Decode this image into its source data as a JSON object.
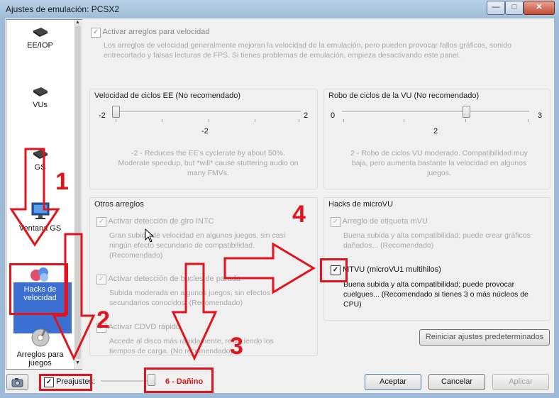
{
  "window": {
    "title": "Ajustes de emulación: PCSX2",
    "minimize": "—",
    "maximize": "□",
    "close": "✕"
  },
  "sidebar": {
    "items": [
      {
        "label": "EE/IOP",
        "icon": "chip-icon"
      },
      {
        "label": "VUs",
        "icon": "chip-icon"
      },
      {
        "label": "GS",
        "icon": "chip-icon"
      },
      {
        "label": "Ventana GS",
        "icon": "monitor-icon"
      },
      {
        "label": "Hacks de velocidad",
        "icon": "hacks-icon",
        "selected": true
      },
      {
        "label": "Arreglos para juegos",
        "icon": "disc-icon"
      }
    ]
  },
  "speed_hacks": {
    "enable_label": "Activar arreglos para velocidad",
    "enable_checked": true,
    "enable_desc": "Los arreglos de velocidad generalmente mejoran la velocidad de la emulación, pero pueden provocar fallos gráficos, sonido entrecortado y falsas lecturas de FPS.  Si tienes problemas de emulación, empieza desactivando este panel."
  },
  "ee_cycle": {
    "title": "Velocidad de ciclos EE (No recomendado)",
    "min": "-2",
    "max": "2",
    "value": "-2",
    "desc": "-2 - Reduces the EE's cyclerate by about 50%. Moderate speedup, but *will* cause stuttering audio on many FMVs."
  },
  "vu_steal": {
    "title": "Robo de ciclos de la VU (No recomendado)",
    "min": "0",
    "max": "3",
    "value": "2",
    "desc": "2 - Robo de ciclos VU moderado. Compatibilidad muy baja, pero aumenta bastante la velocidad en algunos juegos."
  },
  "other_hacks": {
    "title": "Otros arreglos",
    "items": [
      {
        "label": "Activar detección de giro INTC",
        "checked": true,
        "desc": "Gran subida de velocidad en algunos juegos, sin casi ningún efecto secundario de compatibilidad. (Recomendado)"
      },
      {
        "label": "Activar detección de bucles de parada",
        "checked": true,
        "desc": "Subida moderada en algunos juegos, sin efectos secundarios conocidos. (Recomendado)"
      },
      {
        "label": "Activar CDVD rápido",
        "checked": true,
        "desc": "Accede al disco más rápidamente, reduciendo los tiempos de carga. (No recomendado)"
      }
    ]
  },
  "microvu": {
    "title": "Hacks de microVU",
    "items": [
      {
        "label": "Arreglo de etiqueta mVU",
        "checked": true,
        "enabled": false,
        "desc": "Buena subida y alta compatibilidad; puede crear gráficos dañados... (Recomendado)"
      },
      {
        "label": "MTVU (microVU1 multihilos)",
        "checked": true,
        "enabled": true,
        "desc": "Buena subida y alta compatibilidad; puede provocar cuelgues... (Recomendado si tienes 3 o más núcleos de CPU)"
      }
    ]
  },
  "restore_defaults": "Reiniciar ajustes predeterminados",
  "footer": {
    "presets_label": "Preajustes:",
    "presets_checked": true,
    "preset_level": 6,
    "preset_text": "6 - Dañino",
    "accept": "Aceptar",
    "cancel": "Cancelar",
    "apply": "Aplicar"
  },
  "annotations": {
    "n1": "1",
    "n2": "2",
    "n3": "3",
    "n4": "4",
    "color": "#e1141d"
  }
}
